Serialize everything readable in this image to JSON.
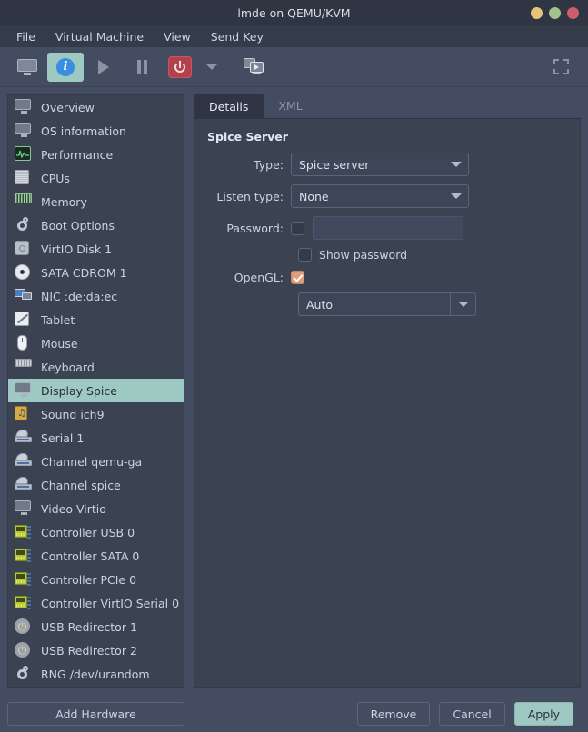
{
  "window": {
    "title": "lmde on QEMU/KVM",
    "controls": [
      {
        "name": "minimize",
        "color": "#e8c37a"
      },
      {
        "name": "maximize",
        "color": "#a2c48b"
      },
      {
        "name": "close",
        "color": "#cc5f6e"
      }
    ]
  },
  "menubar": {
    "items": [
      "File",
      "Virtual Machine",
      "View",
      "Send Key"
    ]
  },
  "toolbar": {
    "buttons": [
      {
        "name": "show-console-button",
        "icon": "monitor-icon",
        "active": false
      },
      {
        "name": "show-details-button",
        "icon": "info-icon",
        "active": true
      },
      {
        "name": "run-button",
        "icon": "play-icon",
        "active": false
      },
      {
        "name": "pause-button",
        "icon": "pause-icon",
        "active": false
      },
      {
        "name": "shutdown-button",
        "icon": "power-icon",
        "active": false
      },
      {
        "name": "shutdown-menu-button",
        "icon": "caret-down-icon",
        "active": false
      },
      {
        "name": "snapshots-button",
        "icon": "screens-icon",
        "active": false
      }
    ],
    "fullscreen": "fullscreen-icon"
  },
  "sidebar": {
    "items": [
      {
        "label": "Overview",
        "icon": "display-icon"
      },
      {
        "label": "OS information",
        "icon": "display-icon"
      },
      {
        "label": "Performance",
        "icon": "performance-graph-icon"
      },
      {
        "label": "CPUs",
        "icon": "cpu-chip-icon"
      },
      {
        "label": "Memory",
        "icon": "memory-stick-icon"
      },
      {
        "label": "Boot Options",
        "icon": "gears-icon"
      },
      {
        "label": "VirtIO Disk 1",
        "icon": "harddisk-icon"
      },
      {
        "label": "SATA CDROM 1",
        "icon": "cdrom-icon"
      },
      {
        "label": "NIC :de:da:ec",
        "icon": "network-icon"
      },
      {
        "label": "Tablet",
        "icon": "tablet-icon"
      },
      {
        "label": "Mouse",
        "icon": "mouse-icon"
      },
      {
        "label": "Keyboard",
        "icon": "keyboard-icon"
      },
      {
        "label": "Display Spice",
        "icon": "display-icon",
        "selected": true
      },
      {
        "label": "Sound ich9",
        "icon": "sound-icon"
      },
      {
        "label": "Serial 1",
        "icon": "serial-port-icon"
      },
      {
        "label": "Channel qemu-ga",
        "icon": "serial-port-icon"
      },
      {
        "label": "Channel spice",
        "icon": "serial-port-icon"
      },
      {
        "label": "Video Virtio",
        "icon": "display-icon"
      },
      {
        "label": "Controller USB 0",
        "icon": "controller-card-icon"
      },
      {
        "label": "Controller SATA 0",
        "icon": "controller-card-icon"
      },
      {
        "label": "Controller PCIe 0",
        "icon": "controller-card-icon"
      },
      {
        "label": "Controller VirtIO Serial 0",
        "icon": "controller-card-icon"
      },
      {
        "label": "USB Redirector 1",
        "icon": "usb-icon"
      },
      {
        "label": "USB Redirector 2",
        "icon": "usb-icon"
      },
      {
        "label": "RNG /dev/urandom",
        "icon": "gears-icon"
      }
    ],
    "add_hardware_label": "Add Hardware"
  },
  "tabs": [
    {
      "label": "Details",
      "active": true
    },
    {
      "label": "XML",
      "active": false
    }
  ],
  "details": {
    "section_title": "Spice Server",
    "type_label": "Type:",
    "type_value": "Spice server",
    "listen_type_label": "Listen type:",
    "listen_type_value": "None",
    "password_label": "Password:",
    "password_value": "",
    "password_placeholder": "",
    "password_enabled": false,
    "show_password_label": "Show password",
    "show_password_checked": false,
    "opengl_label": "OpenGL:",
    "opengl_checked": true,
    "render_node_value": "Auto"
  },
  "footer": {
    "remove_label": "Remove",
    "cancel_label": "Cancel",
    "apply_label": "Apply"
  },
  "colors": {
    "window_bg": "#3b4252",
    "toolbar_bg": "#434c60",
    "titlebar_bg": "#2f3542",
    "accent_teal": "#9ec8c2",
    "accent_salmon": "#e09b78",
    "power_red": "#b2414c",
    "info_blue": "#3a8ee0"
  }
}
